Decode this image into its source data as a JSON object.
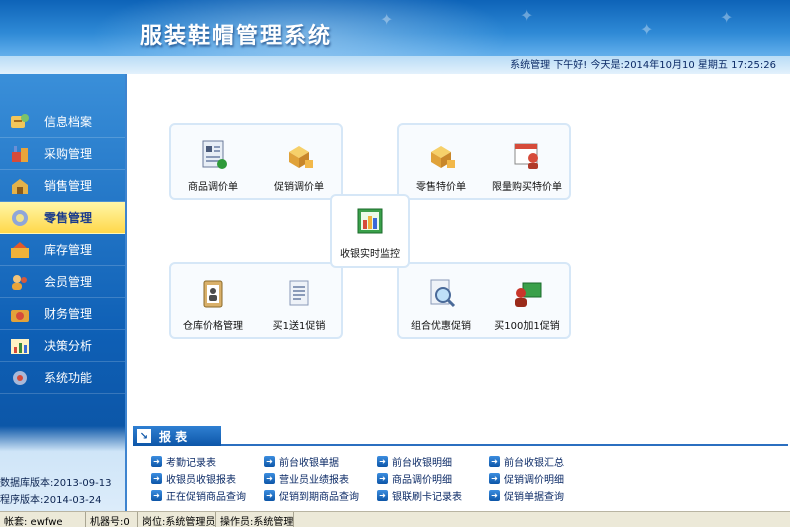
{
  "header": {
    "title": "服装鞋帽管理系统",
    "status_text": "系统管理 下午好! 今天是:2014年10月10 星期五  17:25:26"
  },
  "sidebar": {
    "items": [
      {
        "label": "信息档案",
        "icon": "profile-icon"
      },
      {
        "label": "采购管理",
        "icon": "purchase-icon"
      },
      {
        "label": "销售管理",
        "icon": "sales-icon"
      },
      {
        "label": "零售管理",
        "icon": "retail-icon",
        "active": true
      },
      {
        "label": "库存管理",
        "icon": "inventory-icon"
      },
      {
        "label": "会员管理",
        "icon": "member-icon"
      },
      {
        "label": "财务管理",
        "icon": "finance-icon"
      },
      {
        "label": "决策分析",
        "icon": "analysis-icon"
      },
      {
        "label": "系统功能",
        "icon": "system-icon"
      }
    ],
    "db_version": "数据库版本:2013-09-13",
    "app_version": "程序版本:2014-03-24"
  },
  "functions": {
    "price_adjust": "商品调价单",
    "promo_adjust": "促销调价单",
    "retail_special": "零售特价单",
    "limited_special": "限量购买特价单",
    "cash_monitor": "收银实时监控",
    "warehouse_price": "仓库价格管理",
    "buy1get1": "买1送1促销",
    "combo_promo": "组合优惠促销",
    "buy100add1": "买100加1促销"
  },
  "report": {
    "title": "报 表",
    "links": [
      "考勤记录表",
      "前台收银单据",
      "前台收银明细",
      "前台收银汇总",
      "收银员收银报表",
      "营业员业绩报表",
      "商品调价明细",
      "促销调价明细",
      "正在促销商品查询",
      "促销到期商品查询",
      "银联刷卡记录表",
      "促销单据查询"
    ]
  },
  "statusbar": {
    "account": "帐套: ewfwe",
    "machine": "机器号:0",
    "post": "岗位:系统管理员",
    "operator": "操作员:系统管理"
  },
  "colors": {
    "header_blue": "#2f8ad6",
    "sidebar_blue": "#0e5fb5",
    "active_yellow": "#ffd84a",
    "report_blue": "#0d56a8"
  }
}
